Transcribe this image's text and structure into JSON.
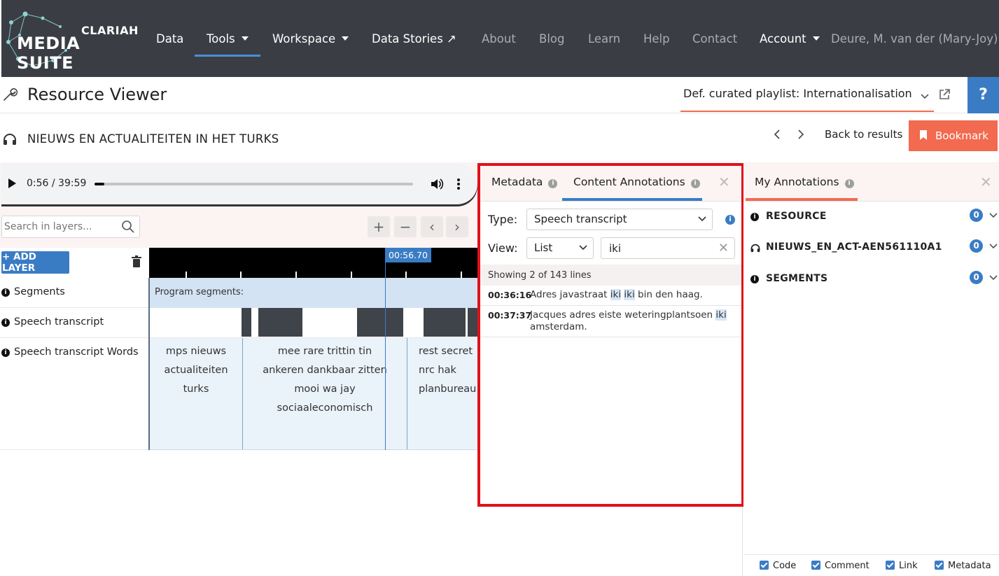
{
  "logo": {
    "line1": "CLARIAH",
    "line2": "MEDIA SUITE"
  },
  "nav": {
    "data": "Data",
    "tools": "Tools",
    "workspace": "Workspace",
    "data_stories": "Data Stories ↗",
    "about": "About",
    "blog": "Blog",
    "learn": "Learn",
    "help": "Help",
    "contact": "Contact",
    "account": "Account",
    "user": "Deure, M. van der (Mary-Joy)"
  },
  "header": {
    "title": "Resource Viewer",
    "playlist": "Def. curated playlist: Internationalisation",
    "help": "?"
  },
  "item": {
    "title": "NIEUWS EN ACTUALITEITEN IN HET TURKS",
    "back": "Back to results",
    "bookmark": "Bookmark"
  },
  "player": {
    "time": "0:56 / 39:59",
    "progress": 0.023
  },
  "layers": {
    "search_placeholder": "Search in layers...",
    "zoom_in": "+",
    "zoom_out": "−",
    "prev": "‹",
    "next": "›",
    "add": "+ ADD LAYER",
    "cursor_time": "00:56.70",
    "rows": [
      {
        "label": "Segments"
      },
      {
        "label": "Speech transcript"
      },
      {
        "label": "Speech transcript Words"
      }
    ],
    "segments_label": "Program segments:",
    "word_cells": [
      {
        "text": "mps nieuws actualiteiten turks"
      },
      {
        "text": "mee rare trittin tin ankeren dankbaar zitten mooi wa jay sociaaleconomisch"
      },
      {
        "text": "rest secret nrc hak planbureau"
      }
    ]
  },
  "content_panel": {
    "tab_metadata": "Metadata",
    "tab_annotations": "Content Annotations",
    "type_label": "Type:",
    "type_value": "Speech transcript",
    "view_label": "View:",
    "view_value": "List",
    "query": "iki",
    "showing": "Showing 2 of 143 lines",
    "results": [
      {
        "time": "00:36:16",
        "before": "Adres javastraat ",
        "hl1": "iki",
        "mid": " ",
        "hl2": "iki",
        "after": " bin den haag."
      },
      {
        "time": "00:37:37",
        "before": "Jacques adres eiste weteringplantsoen ",
        "hl1": "iki",
        "mid": "",
        "hl2": "",
        "after": " amsterdam."
      }
    ]
  },
  "my_annotations": {
    "title": "My Annotations",
    "rows": [
      {
        "label": "RESOURCE",
        "count": "0"
      },
      {
        "label": "NIEUWS_EN_ACT-AEN561110A1",
        "count": "0"
      },
      {
        "label": "SEGMENTS",
        "count": "0"
      }
    ],
    "filters": {
      "code": "Code",
      "comment": "Comment",
      "link": "Link",
      "metadata": "Metadata"
    }
  },
  "colors": {
    "nav_bg": "#3a3e44",
    "accent_blue": "#3a7cc4",
    "accent_orange": "#f26a4f",
    "frame_red": "#e0101b"
  }
}
